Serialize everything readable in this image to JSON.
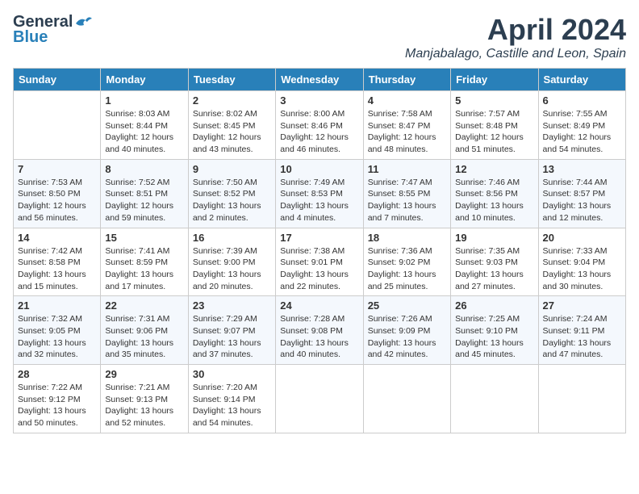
{
  "logo": {
    "general": "General",
    "blue": "Blue"
  },
  "header": {
    "month": "April 2024",
    "location": "Manjabalago, Castille and Leon, Spain"
  },
  "days": [
    "Sunday",
    "Monday",
    "Tuesday",
    "Wednesday",
    "Thursday",
    "Friday",
    "Saturday"
  ],
  "weeks": [
    [
      {
        "day": "",
        "info": ""
      },
      {
        "day": "1",
        "info": "Sunrise: 8:03 AM\nSunset: 8:44 PM\nDaylight: 12 hours\nand 40 minutes."
      },
      {
        "day": "2",
        "info": "Sunrise: 8:02 AM\nSunset: 8:45 PM\nDaylight: 12 hours\nand 43 minutes."
      },
      {
        "day": "3",
        "info": "Sunrise: 8:00 AM\nSunset: 8:46 PM\nDaylight: 12 hours\nand 46 minutes."
      },
      {
        "day": "4",
        "info": "Sunrise: 7:58 AM\nSunset: 8:47 PM\nDaylight: 12 hours\nand 48 minutes."
      },
      {
        "day": "5",
        "info": "Sunrise: 7:57 AM\nSunset: 8:48 PM\nDaylight: 12 hours\nand 51 minutes."
      },
      {
        "day": "6",
        "info": "Sunrise: 7:55 AM\nSunset: 8:49 PM\nDaylight: 12 hours\nand 54 minutes."
      }
    ],
    [
      {
        "day": "7",
        "info": "Sunrise: 7:53 AM\nSunset: 8:50 PM\nDaylight: 12 hours\nand 56 minutes."
      },
      {
        "day": "8",
        "info": "Sunrise: 7:52 AM\nSunset: 8:51 PM\nDaylight: 12 hours\nand 59 minutes."
      },
      {
        "day": "9",
        "info": "Sunrise: 7:50 AM\nSunset: 8:52 PM\nDaylight: 13 hours\nand 2 minutes."
      },
      {
        "day": "10",
        "info": "Sunrise: 7:49 AM\nSunset: 8:53 PM\nDaylight: 13 hours\nand 4 minutes."
      },
      {
        "day": "11",
        "info": "Sunrise: 7:47 AM\nSunset: 8:55 PM\nDaylight: 13 hours\nand 7 minutes."
      },
      {
        "day": "12",
        "info": "Sunrise: 7:46 AM\nSunset: 8:56 PM\nDaylight: 13 hours\nand 10 minutes."
      },
      {
        "day": "13",
        "info": "Sunrise: 7:44 AM\nSunset: 8:57 PM\nDaylight: 13 hours\nand 12 minutes."
      }
    ],
    [
      {
        "day": "14",
        "info": "Sunrise: 7:42 AM\nSunset: 8:58 PM\nDaylight: 13 hours\nand 15 minutes."
      },
      {
        "day": "15",
        "info": "Sunrise: 7:41 AM\nSunset: 8:59 PM\nDaylight: 13 hours\nand 17 minutes."
      },
      {
        "day": "16",
        "info": "Sunrise: 7:39 AM\nSunset: 9:00 PM\nDaylight: 13 hours\nand 20 minutes."
      },
      {
        "day": "17",
        "info": "Sunrise: 7:38 AM\nSunset: 9:01 PM\nDaylight: 13 hours\nand 22 minutes."
      },
      {
        "day": "18",
        "info": "Sunrise: 7:36 AM\nSunset: 9:02 PM\nDaylight: 13 hours\nand 25 minutes."
      },
      {
        "day": "19",
        "info": "Sunrise: 7:35 AM\nSunset: 9:03 PM\nDaylight: 13 hours\nand 27 minutes."
      },
      {
        "day": "20",
        "info": "Sunrise: 7:33 AM\nSunset: 9:04 PM\nDaylight: 13 hours\nand 30 minutes."
      }
    ],
    [
      {
        "day": "21",
        "info": "Sunrise: 7:32 AM\nSunset: 9:05 PM\nDaylight: 13 hours\nand 32 minutes."
      },
      {
        "day": "22",
        "info": "Sunrise: 7:31 AM\nSunset: 9:06 PM\nDaylight: 13 hours\nand 35 minutes."
      },
      {
        "day": "23",
        "info": "Sunrise: 7:29 AM\nSunset: 9:07 PM\nDaylight: 13 hours\nand 37 minutes."
      },
      {
        "day": "24",
        "info": "Sunrise: 7:28 AM\nSunset: 9:08 PM\nDaylight: 13 hours\nand 40 minutes."
      },
      {
        "day": "25",
        "info": "Sunrise: 7:26 AM\nSunset: 9:09 PM\nDaylight: 13 hours\nand 42 minutes."
      },
      {
        "day": "26",
        "info": "Sunrise: 7:25 AM\nSunset: 9:10 PM\nDaylight: 13 hours\nand 45 minutes."
      },
      {
        "day": "27",
        "info": "Sunrise: 7:24 AM\nSunset: 9:11 PM\nDaylight: 13 hours\nand 47 minutes."
      }
    ],
    [
      {
        "day": "28",
        "info": "Sunrise: 7:22 AM\nSunset: 9:12 PM\nDaylight: 13 hours\nand 50 minutes."
      },
      {
        "day": "29",
        "info": "Sunrise: 7:21 AM\nSunset: 9:13 PM\nDaylight: 13 hours\nand 52 minutes."
      },
      {
        "day": "30",
        "info": "Sunrise: 7:20 AM\nSunset: 9:14 PM\nDaylight: 13 hours\nand 54 minutes."
      },
      {
        "day": "",
        "info": ""
      },
      {
        "day": "",
        "info": ""
      },
      {
        "day": "",
        "info": ""
      },
      {
        "day": "",
        "info": ""
      }
    ]
  ]
}
